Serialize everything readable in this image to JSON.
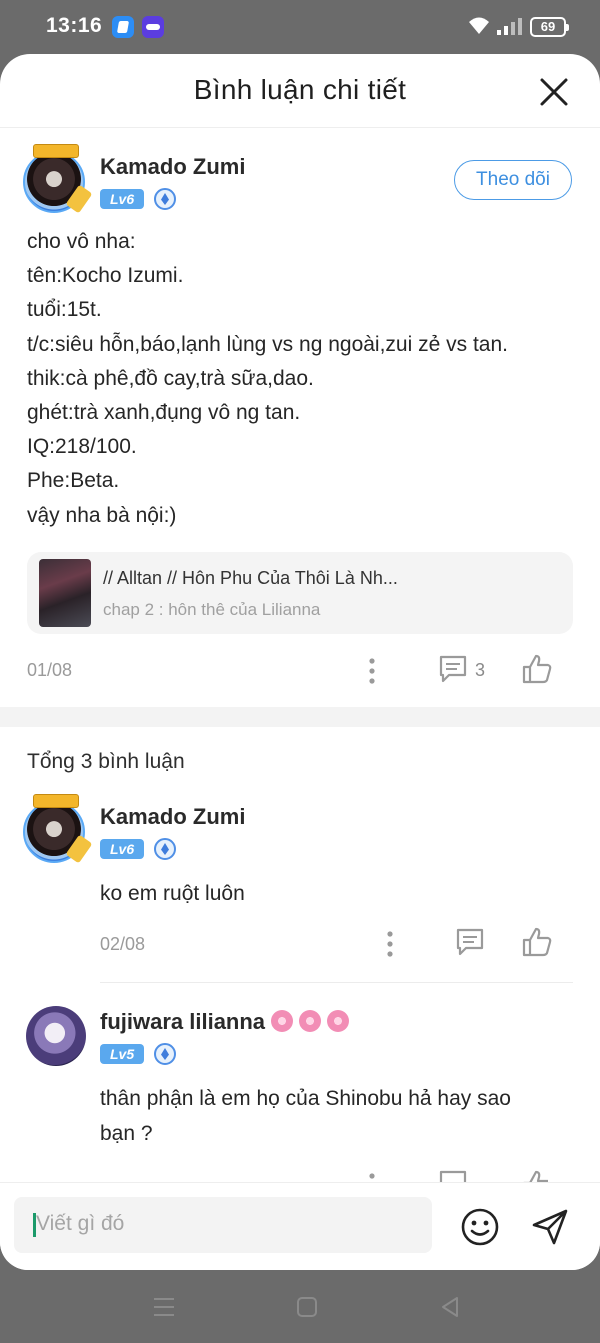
{
  "status_bar": {
    "time": "13:16",
    "battery": "69"
  },
  "header": {
    "title": "Bình luận chi tiết",
    "close_icon": "close-icon"
  },
  "main_comment": {
    "user": {
      "name": "Kamado Zumi",
      "level": "Lv6"
    },
    "follow_label": "Theo dõi",
    "lines": [
      "cho vô nha:",
      "tên:Kocho Izumi.",
      "tuổi:15t.",
      "t/c:siêu hỗn,báo,lạnh lùng vs ng ngoài,zui zẻ vs tan.",
      "thik:cà phê,đồ cay,trà sữa,dao.",
      "ghét:trà xanh,đụng vô ng tan.",
      "IQ:218/100.",
      "Phe:Beta.",
      "vậy nha bà nội:)"
    ],
    "chapter": {
      "title": "// Alltan // Hôn Phu Của Thôi Là Nh...",
      "subtitle": "chap 2 : hôn thê của Lilianna"
    },
    "date": "01/08",
    "reply_count": "3"
  },
  "replies_total": "Tổng 3 bình luận",
  "replies": [
    {
      "name": "Kamado Zumi",
      "level": "Lv6",
      "text": "ko em ruột luôn",
      "date": "02/08"
    },
    {
      "name": "fujiwara lilianna",
      "level": "Lv5",
      "text_lines": [
        "thân phận là em họ của Shinobu hả hay sao",
        "bạn ?"
      ]
    }
  ],
  "input": {
    "placeholder": "Viết gì đó"
  },
  "colors": {
    "accent": "#4c9be6",
    "level_badge": "#5aa8ee"
  }
}
